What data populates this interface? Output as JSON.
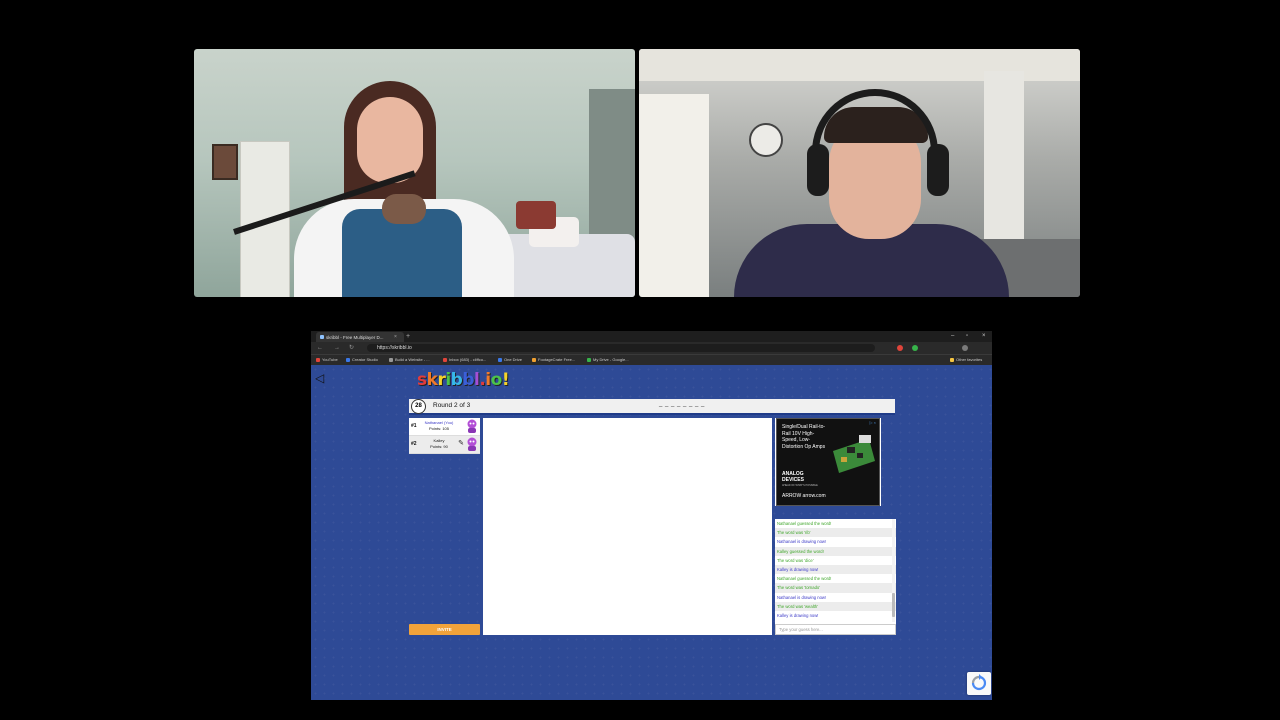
{
  "video_call": {
    "tiles": [
      {
        "id": "left"
      },
      {
        "id": "right"
      }
    ]
  },
  "browser": {
    "tab_title": "skribbl - Free Multiplayer D...",
    "tab_close": "×",
    "new_tab": "+",
    "window_controls": [
      "–",
      "▫",
      "×"
    ],
    "nav": {
      "back": "←",
      "forward": "→",
      "reload": "↻"
    },
    "url": "https://skribbl.io",
    "bookmarks": [
      "YouTube",
      "Creator Studio",
      "Build a Website - ...",
      "Inbox (683) - cliffco...",
      "One Drive",
      "FootageCrate Free...",
      "My Drive - Google..."
    ],
    "other_bookmarks": "Other favorites",
    "extension_colors": [
      "#e0443a",
      "#37b34a",
      "#7a7a7a"
    ]
  },
  "game": {
    "logo": [
      "s",
      "k",
      "r",
      "i",
      "b",
      "b",
      "l",
      ".",
      "i",
      "o",
      "!"
    ],
    "logo_colors": [
      "#e23b3b",
      "#f07a2a",
      "#f5d32b",
      "#4cc34a",
      "#37b7e8",
      "#3b5fd9",
      "#a44fd6",
      "#e23b3b",
      "#f07a2a",
      "#4cc34a",
      "#f5d32b"
    ],
    "timer": "28",
    "round": "Round 2 of 3",
    "word_hint": "_ _ _ _ _ _ _ _",
    "players": [
      {
        "rank": "#1",
        "name": "Nathanael (You)",
        "points": "Points: 105",
        "drawing": false
      },
      {
        "rank": "#2",
        "name": "Kalley",
        "points": "Points: 90",
        "drawing": true
      }
    ],
    "invite_label": "INVITE",
    "ad": {
      "headline": "Single/Dual Rail-to-Rail 10V High-Speed, Low-Distortion Op Amps",
      "brand": "ANALOG DEVICES",
      "tagline": "AHEAD OF WHAT'S POSSIBLE",
      "url": "ARROW arrow.com",
      "close": "▷ ×"
    },
    "chat": {
      "messages": [
        {
          "text": "Nathanael guessed the word!",
          "color": "green"
        },
        {
          "text": "The word was 'rib'",
          "color": "green"
        },
        {
          "text": "Nathanael is drawing now!",
          "color": "blue"
        },
        {
          "text": "Kalley guessed the word!",
          "color": "green"
        },
        {
          "text": "The word was 'dice'",
          "color": "green"
        },
        {
          "text": "Kalley is drawing now!",
          "color": "blue"
        },
        {
          "text": "Nathanael guessed the word!",
          "color": "green"
        },
        {
          "text": "The word was 'tornado'",
          "color": "green"
        },
        {
          "text": "Nathanael is drawing now!",
          "color": "blue"
        },
        {
          "text": "The word was 'wealth'",
          "color": "green"
        },
        {
          "text": "Kalley is drawing now!",
          "color": "blue"
        }
      ],
      "input_placeholder": "Type your guess here..."
    }
  }
}
